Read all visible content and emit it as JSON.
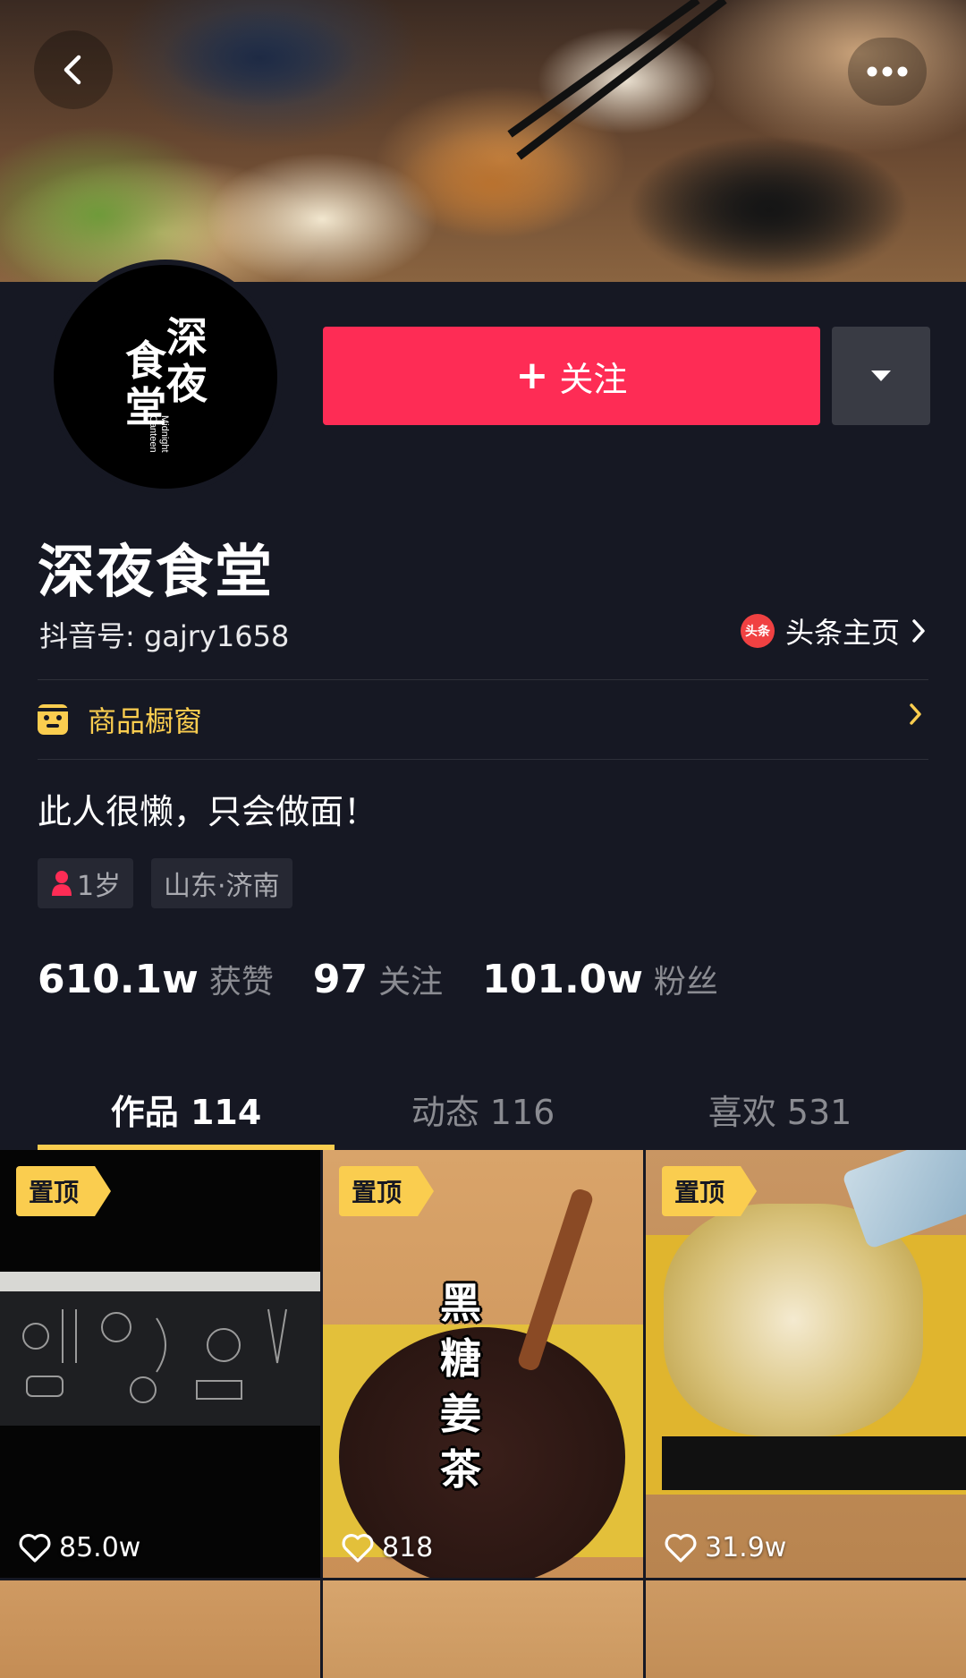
{
  "profile": {
    "name": "深夜食堂",
    "douyin_id": "抖音号: gajry1658",
    "toutiao_label": "头条主页",
    "toutiao_logo_text": "头条",
    "avatar_chars": [
      "深",
      "夜",
      "食",
      "堂"
    ],
    "avatar_en": [
      "Midnight",
      "Canteen"
    ]
  },
  "actions": {
    "follow_plus": "+",
    "follow_label": "关注"
  },
  "shop": {
    "label": "商品橱窗"
  },
  "bio": "此人很懒，只会做面！",
  "tags": {
    "age": "1岁",
    "location": "山东·济南"
  },
  "stats": [
    {
      "value": "610.1w",
      "label": "获赞"
    },
    {
      "value": "97",
      "label": "关注"
    },
    {
      "value": "101.0w",
      "label": "粉丝"
    }
  ],
  "tabs": [
    {
      "label": "作品 114",
      "active": true
    },
    {
      "label": "动态 116",
      "active": false
    },
    {
      "label": "喜欢 531",
      "active": false
    }
  ],
  "videos": [
    {
      "pinned_label": "置顶",
      "likes": "85.0w"
    },
    {
      "pinned_label": "置顶",
      "likes": "818",
      "overlay_text": [
        "黑",
        "糖",
        "姜",
        "茶"
      ]
    },
    {
      "pinned_label": "置顶",
      "likes": "31.9w"
    }
  ],
  "colors": {
    "background": "#161823",
    "follow": "#fe2c55",
    "accent_yellow": "#facd4f",
    "muted_text": "#8a8b91"
  },
  "icons": [
    "back-arrow-icon",
    "more-dots-icon",
    "caret-down-icon",
    "toutiao-logo-icon",
    "chevron-right-icon",
    "shop-window-icon",
    "gender-female-icon",
    "heart-outline-icon"
  ]
}
